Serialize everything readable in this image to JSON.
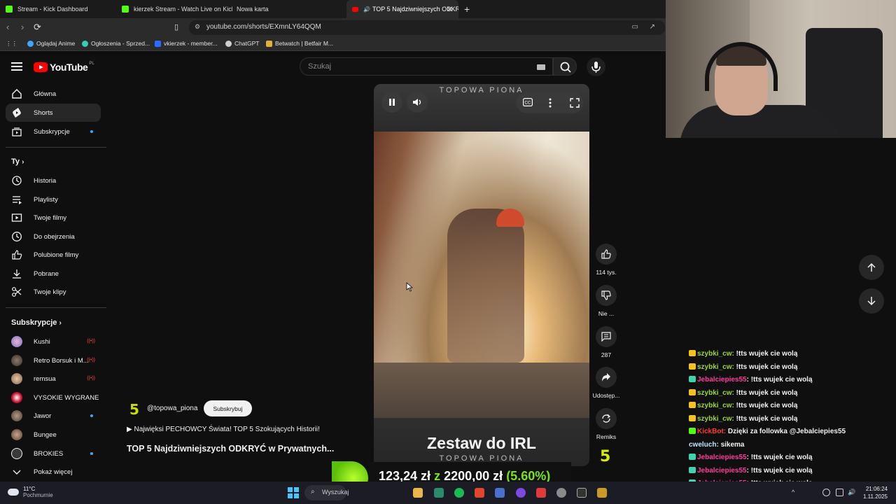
{
  "browser": {
    "tabs": [
      {
        "label": "Stream - Kick Dashboard",
        "active": false
      },
      {
        "label": "kierzek Stream - Watch Live on Kick",
        "active": false
      },
      {
        "label": "Nowa karta",
        "active": false
      },
      {
        "label": "TOP 5 Najdziwniejszych ODKRY",
        "active": true
      }
    ],
    "url": "youtube.com/shorts/EXmnLY64QQM",
    "bookmarks": [
      "Oglądaj Anime",
      "Ogłoszenia - Sprzed...",
      "vkierzek - member...",
      "ChatGPT",
      "Betwatch | Betfair M..."
    ]
  },
  "youtube": {
    "logo_text": "YouTube",
    "logo_region": "PL",
    "search_placeholder": "Szukaj",
    "sidebar": {
      "main": [
        "Główna",
        "Shorts",
        "Subskrypcje"
      ],
      "you_header": "Ty",
      "you": [
        "Historia",
        "Playlisty",
        "Twoje filmy",
        "Do obejrzenia",
        "Polubione filmy",
        "Pobrane",
        "Twoje klipy"
      ],
      "subs_header": "Subskrypcje",
      "subs": [
        "Kushi",
        "Retro Borsuk i M...",
        "remsua",
        "VYSOKIE WYGRANE",
        "Jawor",
        "Bungee",
        "BROKIES"
      ],
      "show_more": "Pokaż więcej"
    },
    "short": {
      "brand_top": "TOPOWA PIONA",
      "headline": "Zestaw do IRL",
      "brand_bottom": "TOPOWA PIONA",
      "actions": [
        {
          "icon": "thumbs-up-icon",
          "label": "114 tys."
        },
        {
          "icon": "thumbs-down-icon",
          "label": "Nie ..."
        },
        {
          "icon": "comment-icon",
          "label": "287"
        },
        {
          "icon": "share-icon",
          "label": "Udostęp..."
        },
        {
          "icon": "remix-icon",
          "label": "Remiks"
        }
      ],
      "channel_logo": "5",
      "channel_name": "@topowa_piona",
      "subscribe_label": "Subskrybuj",
      "playlist_line": "▶ Najwięksi PECHOWCY Świata! TOP 5 Szokujących Historii!",
      "video_title": "TOP 5 Najdziwniejszych ODKRYĆ w Prywatnych..."
    }
  },
  "chat": [
    {
      "user": "szybki_cw",
      "msg": "!tts wujek cie wolą",
      "color": "#9bd341",
      "badge": "#f4c21e"
    },
    {
      "user": "szybki_cw",
      "msg": "!tts wujek cie wolą",
      "color": "#9bd341",
      "badge": "#f4c21e"
    },
    {
      "user": "Jebalciepies55",
      "msg": ": !tts wujek cie wolą",
      "color": "#ff3a9e",
      "badge": "#3fd3b0"
    },
    {
      "user": "szybki_cw",
      "msg": "!tts wujek cie wolą",
      "color": "#9bd341",
      "badge": "#f4c21e"
    },
    {
      "user": "szybki_cw",
      "msg": "!tts wujek cie wolą",
      "color": "#9bd341",
      "badge": "#f4c21e"
    },
    {
      "user": "szybki_cw",
      "msg": "!tts wujek cie wolą",
      "color": "#9bd341",
      "badge": "#f4c21e"
    },
    {
      "user": "KickBot",
      "msg": "Dzięki za followka @Jebalciepies55",
      "color": "#ff3a3a",
      "badge": "#53fc18"
    },
    {
      "user": "cweluch",
      "msg": "sikema",
      "color": "#bfe8ff",
      "badge": ""
    },
    {
      "user": "Jebalciepies55",
      "msg": ": !tts wujek cie wolą",
      "color": "#ff3a9e",
      "badge": "#3fd3b0"
    },
    {
      "user": "Jebalciepies55",
      "msg": ": !tts wujek cie wolą",
      "color": "#ff3a9e",
      "badge": "#3fd3b0"
    },
    {
      "user": "Jebalciepies55",
      "msg": ": !tts wujek cie wolą",
      "color": "#ff3a9e",
      "badge": "#3fd3b0"
    },
    {
      "user": "Jebalciepies55",
      "msg": ": !tts wujek cie wolą",
      "color": "#ff3a9e",
      "badge": "#3fd3b0"
    }
  ],
  "money_overlay": {
    "current": "123,24 zł",
    "of": "z",
    "goal": "2200,00 zł",
    "percent": "(5.60%)"
  },
  "taskbar": {
    "temp": "11°C",
    "weather": "Pochmurnie",
    "search_placeholder": "Wyszukaj",
    "time": "21:06:24",
    "date": "1.11.2025"
  }
}
